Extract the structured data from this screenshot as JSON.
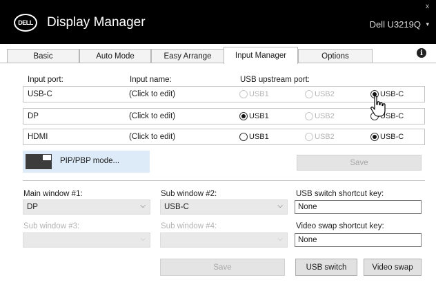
{
  "app": {
    "logo": "DELL",
    "title": "Display Manager",
    "monitor": "Dell U3219Q",
    "close": "x",
    "caret": "▾"
  },
  "tabs": [
    {
      "label": "Basic",
      "active": false
    },
    {
      "label": "Auto Mode",
      "active": false
    },
    {
      "label": "Easy Arrange",
      "active": false
    },
    {
      "label": "Input Manager",
      "active": true
    },
    {
      "label": "Options",
      "active": false
    }
  ],
  "info_icon": "i",
  "input_table": {
    "headers": {
      "port": "Input port:",
      "name": "Input name:",
      "usb": "USB upstream port:"
    },
    "rows": [
      {
        "port": "USB-C",
        "name": "(Click to edit)",
        "usb1": "USB1",
        "usb2": "USB2",
        "usbc": "USB-C",
        "selected": "usbc"
      },
      {
        "port": "DP",
        "name": "(Click to edit)",
        "usb1": "USB1",
        "usb2": "USB2",
        "usbc": "USB-C",
        "selected": "usb1"
      },
      {
        "port": "HDMI",
        "name": "(Click to edit)",
        "usb1": "USB1",
        "usb2": "USB2",
        "usbc": "USB-C",
        "selected": "usbc"
      }
    ]
  },
  "pip_label": "PIP/PBP mode...",
  "save_label": "Save",
  "windows": {
    "main1": {
      "label": "Main window #1:",
      "value": "DP"
    },
    "sub2": {
      "label": "Sub window #2:",
      "value": "USB-C"
    },
    "sub3": {
      "label": "Sub window #3:",
      "value": ""
    },
    "sub4": {
      "label": "Sub window #4:",
      "value": ""
    }
  },
  "shortcuts": {
    "usb_label": "USB switch shortcut key:",
    "usb_value": "None",
    "video_label": "Video swap shortcut key:",
    "video_value": "None"
  },
  "buttons": {
    "save2": "Save",
    "usb_switch": "USB switch",
    "video_swap": "Video swap"
  },
  "chevron": "⌵"
}
